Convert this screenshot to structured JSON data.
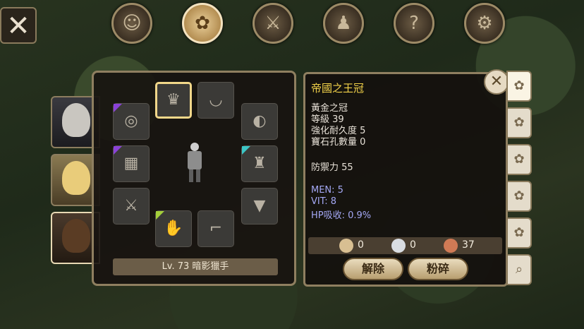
{
  "window": {
    "close_icon": "close-x-icon"
  },
  "top_nav": [
    {
      "icon": "character-head-icon",
      "glyph": "☺",
      "active": false
    },
    {
      "icon": "bag-icon",
      "glyph": "👝",
      "active": true
    },
    {
      "icon": "sword-icon",
      "glyph": "⚔",
      "active": false
    },
    {
      "icon": "party-icon",
      "glyph": "👥",
      "active": false
    },
    {
      "icon": "quest-scroll-icon",
      "glyph": "?",
      "active": false
    },
    {
      "icon": "gear-icon",
      "glyph": "⚙",
      "active": false
    }
  ],
  "portraits": [
    {
      "name": "portrait-white-hair",
      "selected": false
    },
    {
      "name": "portrait-blonde",
      "selected": false
    },
    {
      "name": "portrait-dark-hair",
      "selected": true
    }
  ],
  "equipment": {
    "character_label": "Lv. 73 暗影獵手",
    "slots": [
      {
        "name": "crown-slot",
        "icon": "crown-icon",
        "glyph": "♛",
        "selected": true,
        "tag": ""
      },
      {
        "name": "necklace-slot",
        "icon": "necklace-icon",
        "glyph": "◡",
        "selected": false,
        "tag": ""
      },
      {
        "name": "ring-slot",
        "icon": "ring-icon",
        "glyph": "◎",
        "selected": false,
        "tag": "purple"
      },
      {
        "name": "shield-slot-empty",
        "icon": "shield-icon",
        "glyph": "◐",
        "selected": false,
        "tag": ""
      },
      {
        "name": "armor-slot",
        "icon": "armor-icon",
        "glyph": "▦",
        "selected": false,
        "tag": "purple"
      },
      {
        "name": "cloak-slot",
        "icon": "cloak-icon",
        "glyph": "♜",
        "selected": false,
        "tag": "teal"
      },
      {
        "name": "weapon-slot-empty",
        "icon": "sword-icon",
        "glyph": "⚔",
        "selected": false,
        "tag": ""
      },
      {
        "name": "belt-slot-empty",
        "icon": "belt-icon",
        "glyph": "▼",
        "selected": false,
        "tag": ""
      },
      {
        "name": "gloves-slot",
        "icon": "gloves-icon",
        "glyph": "✋",
        "selected": false,
        "tag": "lime"
      },
      {
        "name": "boots-slot-empty",
        "icon": "boots-icon",
        "glyph": "⌐",
        "selected": false,
        "tag": ""
      }
    ]
  },
  "item_info": {
    "title": "帝國之王冠",
    "type": "黃金之冠",
    "level": "等級 39",
    "durability": "強化耐久度 5",
    "sockets": "寶石孔數量 0",
    "defense": "防禦力 55",
    "stat_men": "MEN: 5",
    "stat_vit": "VIT: 8",
    "stat_hp": "HP吸收: 0.9%",
    "currency": {
      "gold": "0",
      "silver": "0",
      "copper": "37"
    },
    "btn_unequip": "解除",
    "btn_shatter": "粉碎"
  },
  "bag_tabs": [
    "bag-1",
    "bag-2",
    "bag-3",
    "bag-4",
    "bag-5",
    "bag-6",
    "bag-search"
  ],
  "colors": {
    "title_yellow": "#f3d34a",
    "stat_blue": "#a4a8f4",
    "panel_border": "#8f7f60"
  }
}
